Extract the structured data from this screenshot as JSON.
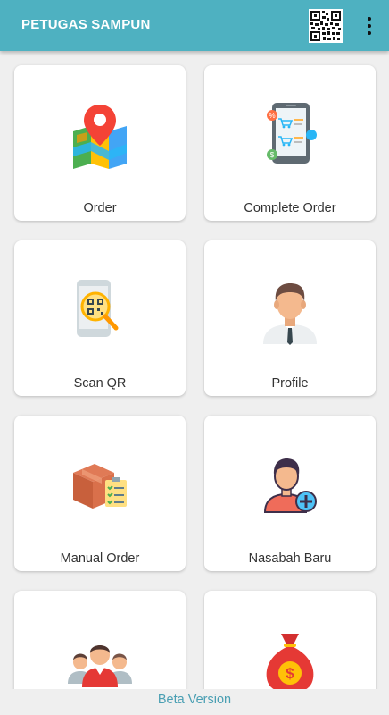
{
  "appbar": {
    "title": "PETUGAS SAMPUN",
    "qr_icon": "qr-code-icon",
    "menu_icon": "more-vert-icon",
    "color": "#4eb1c1"
  },
  "menu": {
    "items": [
      {
        "label": "Order",
        "icon": "map-location-icon"
      },
      {
        "label": "Complete Order",
        "icon": "tablet-shopping-icon"
      },
      {
        "label": "Scan QR",
        "icon": "scan-qr-icon"
      },
      {
        "label": "Profile",
        "icon": "profile-person-icon"
      },
      {
        "label": "Manual Order",
        "icon": "box-clipboard-icon"
      },
      {
        "label": "Nasabah Baru",
        "icon": "add-customer-icon"
      },
      {
        "label": "",
        "icon": "group-people-icon"
      },
      {
        "label": "",
        "icon": "money-bag-icon"
      }
    ]
  },
  "footer": {
    "text": "Beta Version"
  }
}
